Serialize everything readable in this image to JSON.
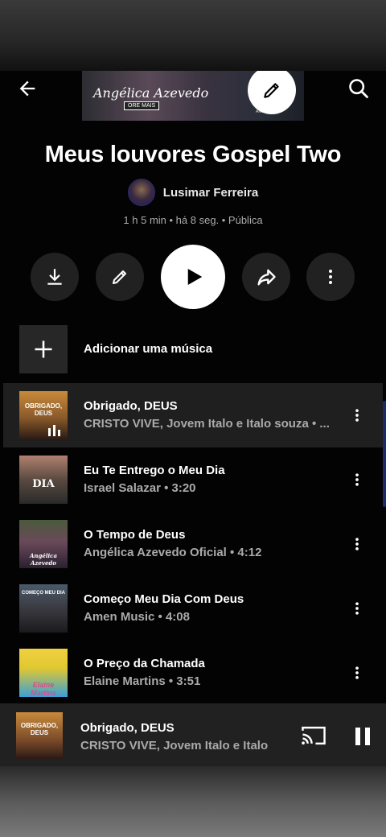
{
  "cover": {
    "title": "Angélica Azevedo",
    "badge": "ORE MAIS",
    "label": "AMEN MUSIC"
  },
  "playlist": {
    "title": "Meus louvores Gospel Two",
    "author": "Lusimar Ferreira",
    "meta": "1 h 5 min • há 8 seg. • Pública"
  },
  "add_song_label": "Adicionar uma música",
  "tracks": [
    {
      "title": "Obrigado, DEUS",
      "subtitle": "CRISTO VIVE, Jovem Italo e Italo souza • ...",
      "thumb_text": "OBRIGADO, DEUS",
      "playing": true
    },
    {
      "title": "Eu Te Entrego o Meu Dia",
      "subtitle": "Israel Salazar • 3:20",
      "thumb_text": "DIA"
    },
    {
      "title": "O Tempo de Deus",
      "subtitle": "Angélica Azevedo Oficial • 4:12",
      "thumb_text": "Angélica Azevedo"
    },
    {
      "title": "Começo Meu Dia Com Deus",
      "subtitle": "Amen Music • 4:08",
      "thumb_text": "COMEÇO MEU DIA"
    },
    {
      "title": "O Preço da Chamada",
      "subtitle": "Elaine Martins • 3:51",
      "thumb_text": "Elaine Martins"
    }
  ],
  "now_playing": {
    "title": "Obrigado, DEUS",
    "subtitle": "CRISTO VIVE, Jovem Italo e Italo",
    "thumb_text": "OBRIGADO, DEUS"
  },
  "colors": {
    "background": "#030303",
    "active_row": "#1f1f1f",
    "button_bg": "#212121",
    "secondary_text": "#aaaaaa"
  }
}
